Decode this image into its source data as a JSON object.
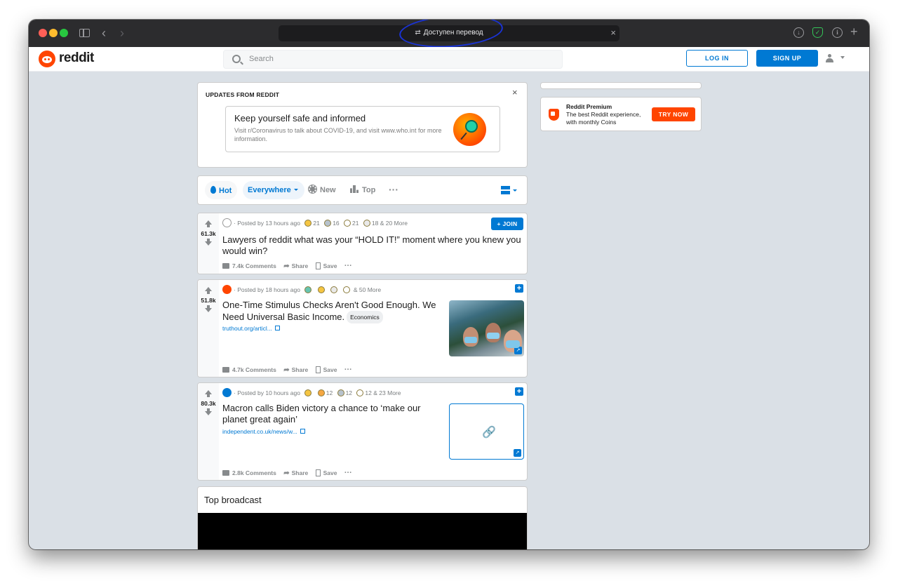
{
  "browser": {
    "address_text": "Доступен перевод"
  },
  "header": {
    "logo_text": "reddit",
    "search_placeholder": "Search",
    "login_label": "LOG IN",
    "signup_label": "SIGN UP"
  },
  "updates": {
    "title": "UPDATES FROM REDDIT",
    "heading": "Keep yourself safe and informed",
    "body": "Visit r/Coronavirus to talk about COVID-19, and visit www.who.int for more information."
  },
  "sort": {
    "hot": "Hot",
    "everywhere": "Everywhere",
    "new": "New",
    "top": "Top",
    "more": "···"
  },
  "posts": [
    {
      "votes": "61.3k",
      "meta_posted": "· Posted by 13 hours ago",
      "awards": [
        "21",
        "16",
        "21",
        "18"
      ],
      "more_awards": "& 20 More",
      "title": "Lawyers of reddit what was your “HOLD IT!” moment where you knew you would win?",
      "join": "+ JOIN",
      "comments": "7.4k Comments",
      "share": "Share",
      "save": "Save"
    },
    {
      "votes": "51.8k",
      "meta_posted": "· Posted by 18 hours ago",
      "more_awards": "& 50 More",
      "title": "One-Time Stimulus Checks Aren't Good Enough. We Need Universal Basic Income.",
      "flair": "Economics",
      "link": "truthout.org/articl...",
      "comments": "4.7k Comments",
      "share": "Share",
      "save": "Save"
    },
    {
      "votes": "80.3k",
      "meta_posted": "· Posted by 10 hours ago",
      "awards": [
        "12",
        "12",
        "12"
      ],
      "more_awards": "& 23 More",
      "title": "Macron calls Biden victory a chance to ‘make our planet great again’",
      "link": "independent.co.uk/news/w...",
      "comments": "2.8k Comments",
      "share": "Share",
      "save": "Save"
    }
  ],
  "broadcast": {
    "title": "Top broadcast"
  },
  "premium": {
    "title": "Reddit Premium",
    "body": "The best Reddit experience, with monthly Coins",
    "cta": "TRY NOW"
  },
  "colors": {
    "reddit_orange": "#ff4500",
    "reddit_blue": "#0079d3",
    "feed_background": "#dae0e6"
  }
}
